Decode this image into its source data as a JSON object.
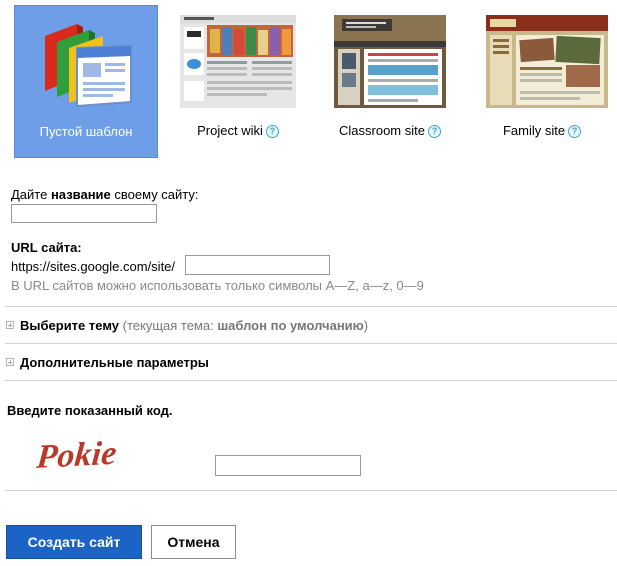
{
  "templates": [
    {
      "label": "Пустой шаблон",
      "selected": true
    },
    {
      "label": "Project wiki",
      "help": "?"
    },
    {
      "label": "Classroom site",
      "help": "?"
    },
    {
      "label": "Family site",
      "help": "?"
    }
  ],
  "site_name": {
    "label_prefix": "Дайте ",
    "label_bold": "название",
    "label_suffix": " своему сайту:",
    "value": ""
  },
  "url": {
    "title": "URL сайта:",
    "prefix": "https://sites.google.com/site/",
    "value": "",
    "hint": "В URL сайтов можно использовать только символы A—Z, a—z, 0—9"
  },
  "theme": {
    "title": "Выберите тему",
    "note_prefix": " (текущая тема: ",
    "note_bold": "шаблон по умолчанию",
    "note_suffix": ")"
  },
  "advanced": {
    "title": "Дополнительные параметры"
  },
  "captcha": {
    "title": "Введите показанный код.",
    "image_text": "Pokie",
    "value": ""
  },
  "buttons": {
    "create": "Создать сайт",
    "cancel": "Отмена"
  },
  "colors": {
    "selected_bg": "#6f9ee8",
    "primary_button": "#1c63c6",
    "help_icon": "#3aa7c8",
    "hint_text": "#8a8a8a"
  }
}
